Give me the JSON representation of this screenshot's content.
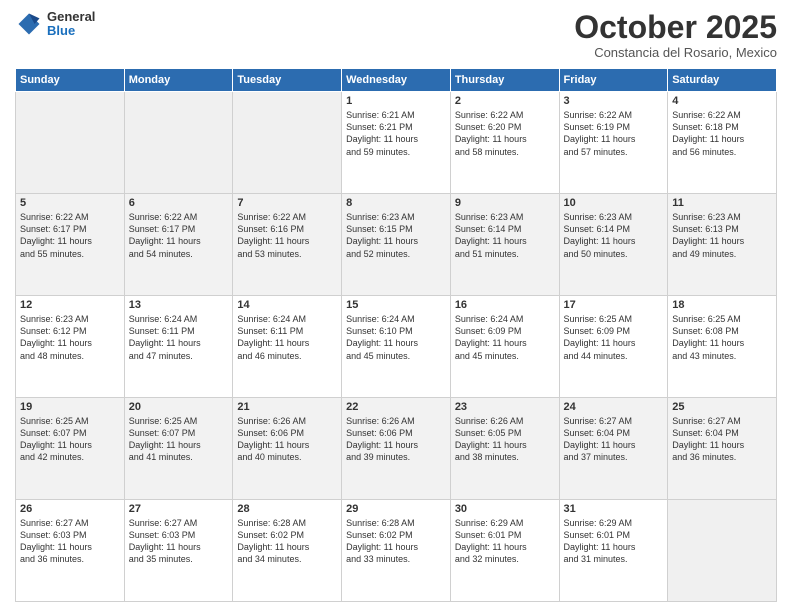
{
  "header": {
    "logo": {
      "general": "General",
      "blue": "Blue"
    },
    "month": "October 2025",
    "location": "Constancia del Rosario, Mexico"
  },
  "days_of_week": [
    "Sunday",
    "Monday",
    "Tuesday",
    "Wednesday",
    "Thursday",
    "Friday",
    "Saturday"
  ],
  "weeks": [
    [
      {
        "day": "",
        "info": ""
      },
      {
        "day": "",
        "info": ""
      },
      {
        "day": "",
        "info": ""
      },
      {
        "day": "1",
        "info": "Sunrise: 6:21 AM\nSunset: 6:21 PM\nDaylight: 11 hours\nand 59 minutes."
      },
      {
        "day": "2",
        "info": "Sunrise: 6:22 AM\nSunset: 6:20 PM\nDaylight: 11 hours\nand 58 minutes."
      },
      {
        "day": "3",
        "info": "Sunrise: 6:22 AM\nSunset: 6:19 PM\nDaylight: 11 hours\nand 57 minutes."
      },
      {
        "day": "4",
        "info": "Sunrise: 6:22 AM\nSunset: 6:18 PM\nDaylight: 11 hours\nand 56 minutes."
      }
    ],
    [
      {
        "day": "5",
        "info": "Sunrise: 6:22 AM\nSunset: 6:17 PM\nDaylight: 11 hours\nand 55 minutes."
      },
      {
        "day": "6",
        "info": "Sunrise: 6:22 AM\nSunset: 6:17 PM\nDaylight: 11 hours\nand 54 minutes."
      },
      {
        "day": "7",
        "info": "Sunrise: 6:22 AM\nSunset: 6:16 PM\nDaylight: 11 hours\nand 53 minutes."
      },
      {
        "day": "8",
        "info": "Sunrise: 6:23 AM\nSunset: 6:15 PM\nDaylight: 11 hours\nand 52 minutes."
      },
      {
        "day": "9",
        "info": "Sunrise: 6:23 AM\nSunset: 6:14 PM\nDaylight: 11 hours\nand 51 minutes."
      },
      {
        "day": "10",
        "info": "Sunrise: 6:23 AM\nSunset: 6:14 PM\nDaylight: 11 hours\nand 50 minutes."
      },
      {
        "day": "11",
        "info": "Sunrise: 6:23 AM\nSunset: 6:13 PM\nDaylight: 11 hours\nand 49 minutes."
      }
    ],
    [
      {
        "day": "12",
        "info": "Sunrise: 6:23 AM\nSunset: 6:12 PM\nDaylight: 11 hours\nand 48 minutes."
      },
      {
        "day": "13",
        "info": "Sunrise: 6:24 AM\nSunset: 6:11 PM\nDaylight: 11 hours\nand 47 minutes."
      },
      {
        "day": "14",
        "info": "Sunrise: 6:24 AM\nSunset: 6:11 PM\nDaylight: 11 hours\nand 46 minutes."
      },
      {
        "day": "15",
        "info": "Sunrise: 6:24 AM\nSunset: 6:10 PM\nDaylight: 11 hours\nand 45 minutes."
      },
      {
        "day": "16",
        "info": "Sunrise: 6:24 AM\nSunset: 6:09 PM\nDaylight: 11 hours\nand 45 minutes."
      },
      {
        "day": "17",
        "info": "Sunrise: 6:25 AM\nSunset: 6:09 PM\nDaylight: 11 hours\nand 44 minutes."
      },
      {
        "day": "18",
        "info": "Sunrise: 6:25 AM\nSunset: 6:08 PM\nDaylight: 11 hours\nand 43 minutes."
      }
    ],
    [
      {
        "day": "19",
        "info": "Sunrise: 6:25 AM\nSunset: 6:07 PM\nDaylight: 11 hours\nand 42 minutes."
      },
      {
        "day": "20",
        "info": "Sunrise: 6:25 AM\nSunset: 6:07 PM\nDaylight: 11 hours\nand 41 minutes."
      },
      {
        "day": "21",
        "info": "Sunrise: 6:26 AM\nSunset: 6:06 PM\nDaylight: 11 hours\nand 40 minutes."
      },
      {
        "day": "22",
        "info": "Sunrise: 6:26 AM\nSunset: 6:06 PM\nDaylight: 11 hours\nand 39 minutes."
      },
      {
        "day": "23",
        "info": "Sunrise: 6:26 AM\nSunset: 6:05 PM\nDaylight: 11 hours\nand 38 minutes."
      },
      {
        "day": "24",
        "info": "Sunrise: 6:27 AM\nSunset: 6:04 PM\nDaylight: 11 hours\nand 37 minutes."
      },
      {
        "day": "25",
        "info": "Sunrise: 6:27 AM\nSunset: 6:04 PM\nDaylight: 11 hours\nand 36 minutes."
      }
    ],
    [
      {
        "day": "26",
        "info": "Sunrise: 6:27 AM\nSunset: 6:03 PM\nDaylight: 11 hours\nand 36 minutes."
      },
      {
        "day": "27",
        "info": "Sunrise: 6:27 AM\nSunset: 6:03 PM\nDaylight: 11 hours\nand 35 minutes."
      },
      {
        "day": "28",
        "info": "Sunrise: 6:28 AM\nSunset: 6:02 PM\nDaylight: 11 hours\nand 34 minutes."
      },
      {
        "day": "29",
        "info": "Sunrise: 6:28 AM\nSunset: 6:02 PM\nDaylight: 11 hours\nand 33 minutes."
      },
      {
        "day": "30",
        "info": "Sunrise: 6:29 AM\nSunset: 6:01 PM\nDaylight: 11 hours\nand 32 minutes."
      },
      {
        "day": "31",
        "info": "Sunrise: 6:29 AM\nSunset: 6:01 PM\nDaylight: 11 hours\nand 31 minutes."
      },
      {
        "day": "",
        "info": ""
      }
    ]
  ]
}
